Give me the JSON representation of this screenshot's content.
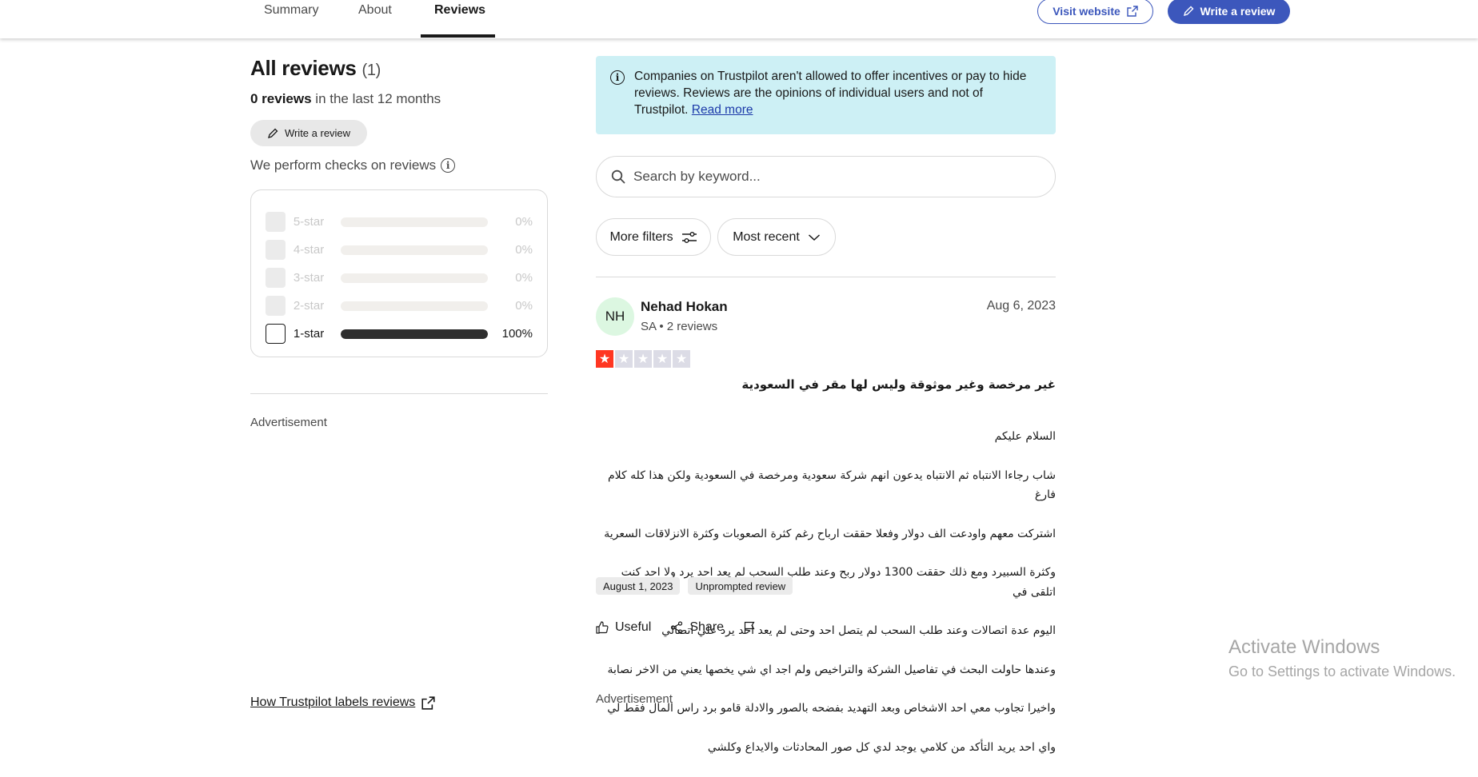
{
  "nav": {
    "tabs": [
      {
        "label": "Summary"
      },
      {
        "label": "About"
      },
      {
        "label": "Reviews"
      }
    ],
    "visit_website": "Visit website",
    "write_review": "Write a review"
  },
  "left": {
    "heading": "All reviews",
    "heading_count": "(1)",
    "recent_count": "0 reviews",
    "recent_suffix": "in the last 12 months",
    "write_review": "Write a review",
    "checks": "We perform checks on reviews",
    "distribution": [
      {
        "label": "5-star",
        "percent": 0,
        "percent_text": "0%",
        "active": false
      },
      {
        "label": "4-star",
        "percent": 0,
        "percent_text": "0%",
        "active": false
      },
      {
        "label": "3-star",
        "percent": 0,
        "percent_text": "0%",
        "active": false
      },
      {
        "label": "2-star",
        "percent": 0,
        "percent_text": "0%",
        "active": false
      },
      {
        "label": "1-star",
        "percent": 100,
        "percent_text": "100%",
        "active": true
      }
    ],
    "advertisement": "Advertisement",
    "how_labels": "How Trustpilot labels reviews"
  },
  "right": {
    "notice_text": "Companies on Trustpilot aren't allowed to offer incentives or pay to hide reviews. Reviews are the opinions of individual users and not of Trustpilot.",
    "notice_link": "Read more",
    "search_placeholder": "Search by keyword...",
    "more_filters": "More filters",
    "sort": "Most recent",
    "advertisement": "Advertisement"
  },
  "review": {
    "initials": "NH",
    "name": "Nehad Hokan",
    "meta": "SA • 2 reviews",
    "date": "Aug 6, 2023",
    "rating": 1,
    "title": "غير مرخصة وغير موثوقة وليس لها مقر في السعودية",
    "body_lines": [
      "السلام عليكم",
      "شاب رجاءا الانتباه ثم الانتباه يدعون انهم شركة سعودية ومرخصة في السعودية ولكن هذا كله كلام فارغ",
      "اشتركت معهم واودعت الف دولار وفعلا حققت ارباح رغم كثرة الصعوبات وكثرة الانزلاقات السعرية",
      "وكثرة السبيرد ومع ذلك حققت 1300 دولار ربح وعند طلب السحب لم يعد احد يرد ولا احد كنت اتلقى في",
      "اليوم عدة اتصالات وعند طلب السحب لم يتصل احد وحتى لم يعد احد يرد علي اتصالي",
      "وعندها حاولت البحث في تفاصيل الشركة والتراخيص ولم اجد اي شي يخصها يعني من الاخر نصابة",
      "واخيرا تجاوب معي احد الاشخاص وبعد التهديد بفضحه بالصور والادلة قامو برد راس المال فقط لي",
      "واي احد يريد التأكد من كلامي يوجد لدي كل صور المحادثات والايداع وكلشي"
    ],
    "experience_date": "August 1, 2023",
    "label": "Unprompted review",
    "useful": "Useful",
    "share": "Share"
  },
  "watermark": {
    "line1": "Activate Windows",
    "line2": "Go to Settings to activate Windows."
  }
}
